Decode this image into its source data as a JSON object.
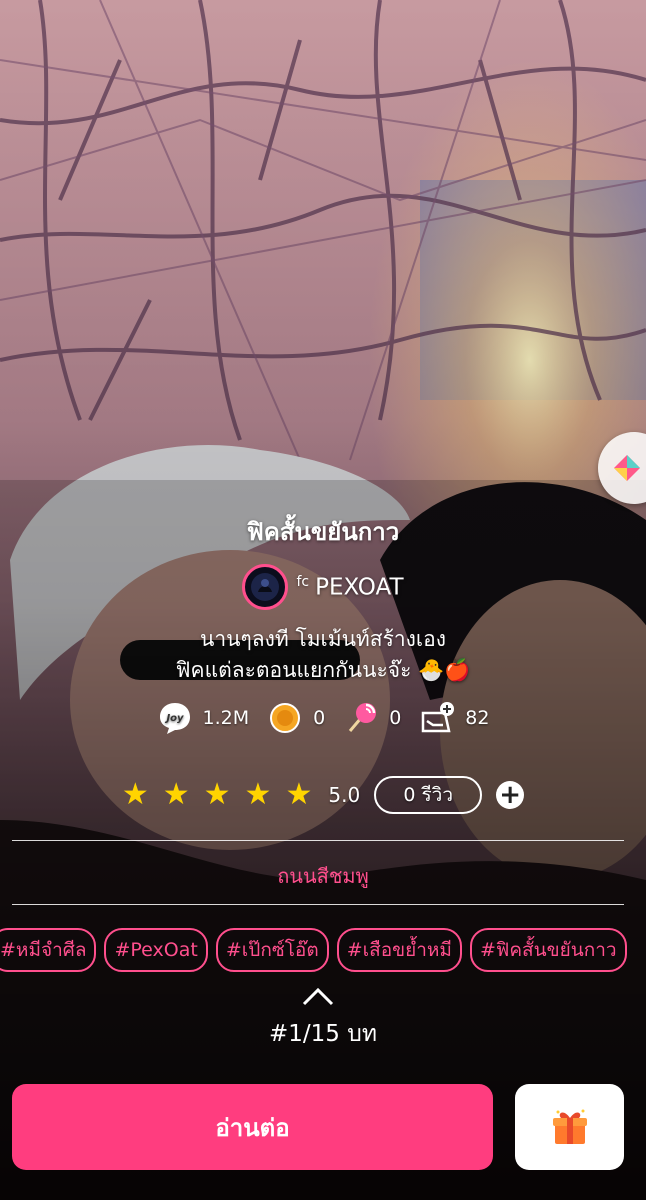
{
  "story": {
    "title": "ฟิคสั้นขยันกาว",
    "author_prefix": "fc",
    "author_name": "PEXOAT",
    "description_line1": "นานๆลงที โมเม้นท์สร้างเอง",
    "description_line2": "ฟิคแต่ละตอนแยกกันนะจ๊ะ 🐣🍎"
  },
  "stats": [
    {
      "icon": "joy-icon",
      "value": "1.2M"
    },
    {
      "icon": "coin-icon",
      "value": "0"
    },
    {
      "icon": "lollipop-icon",
      "value": "0"
    },
    {
      "icon": "library-add-icon",
      "value": "82"
    }
  ],
  "rating": {
    "stars": 5,
    "value": "5.0",
    "review_label": "0 รีวิว",
    "add_label": "+"
  },
  "category": "ถนนสีชมพู",
  "tags": [
    "#หมีจำศีล",
    "#PexOat",
    "#เป๊กซ์โอ๊ต",
    "#เสือขย้ำหมี",
    "#ฟิคสั้นขยันกาว"
  ],
  "chapter": "#1/15 บท",
  "actions": {
    "read_label": "อ่านต่อ",
    "gift_icon": "gift-icon"
  },
  "colors": {
    "accent": "#ff3d7f",
    "tag": "#ff4f8d",
    "star": "#ffd400"
  }
}
